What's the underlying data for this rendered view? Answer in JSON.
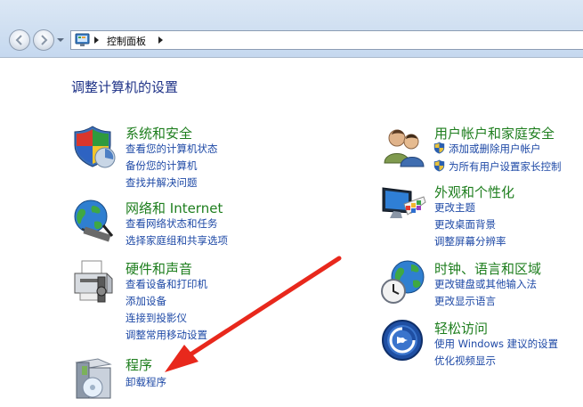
{
  "address": {
    "breadcrumb": "控制面板"
  },
  "page": {
    "title": "调整计算机的设置"
  },
  "categories": {
    "system": {
      "title": "系统和安全",
      "links": [
        "查看您的计算机状态",
        "备份您的计算机",
        "查找并解决问题"
      ]
    },
    "network": {
      "title": "网络和 Internet",
      "links": [
        "查看网络状态和任务",
        "选择家庭组和共享选项"
      ]
    },
    "hardware": {
      "title": "硬件和声音",
      "links": [
        "查看设备和打印机",
        "添加设备",
        "连接到投影仪",
        "调整常用移动设置"
      ]
    },
    "programs": {
      "title": "程序",
      "links": [
        "卸载程序"
      ]
    },
    "users": {
      "title": "用户帐户和家庭安全",
      "links": [
        "添加或删除用户帐户",
        "为所有用户设置家长控制"
      ]
    },
    "appearance": {
      "title": "外观和个性化",
      "links": [
        "更改主题",
        "更改桌面背景",
        "调整屏幕分辨率"
      ]
    },
    "clock": {
      "title": "时钟、语言和区域",
      "links": [
        "更改键盘或其他输入法",
        "更改显示语言"
      ]
    },
    "access": {
      "title": "轻松访问",
      "links": [
        "使用 Windows 建议的设置",
        "优化视频显示"
      ]
    }
  },
  "icons": {
    "system": "shield-icon",
    "network": "globe-network-icon",
    "hardware": "printer-icon",
    "programs": "program-box-icon",
    "users": "users-icon",
    "appearance": "monitor-palette-icon",
    "clock": "globe-clock-icon",
    "access": "ease-of-access-icon",
    "uac": "uac-shield-icon",
    "annotation": "red-arrow-icon"
  },
  "colors": {
    "category_title": "#1e7e1e",
    "link": "#1e49a6",
    "page_title": "#1e3287",
    "annotation_arrow": "#e8281c"
  }
}
